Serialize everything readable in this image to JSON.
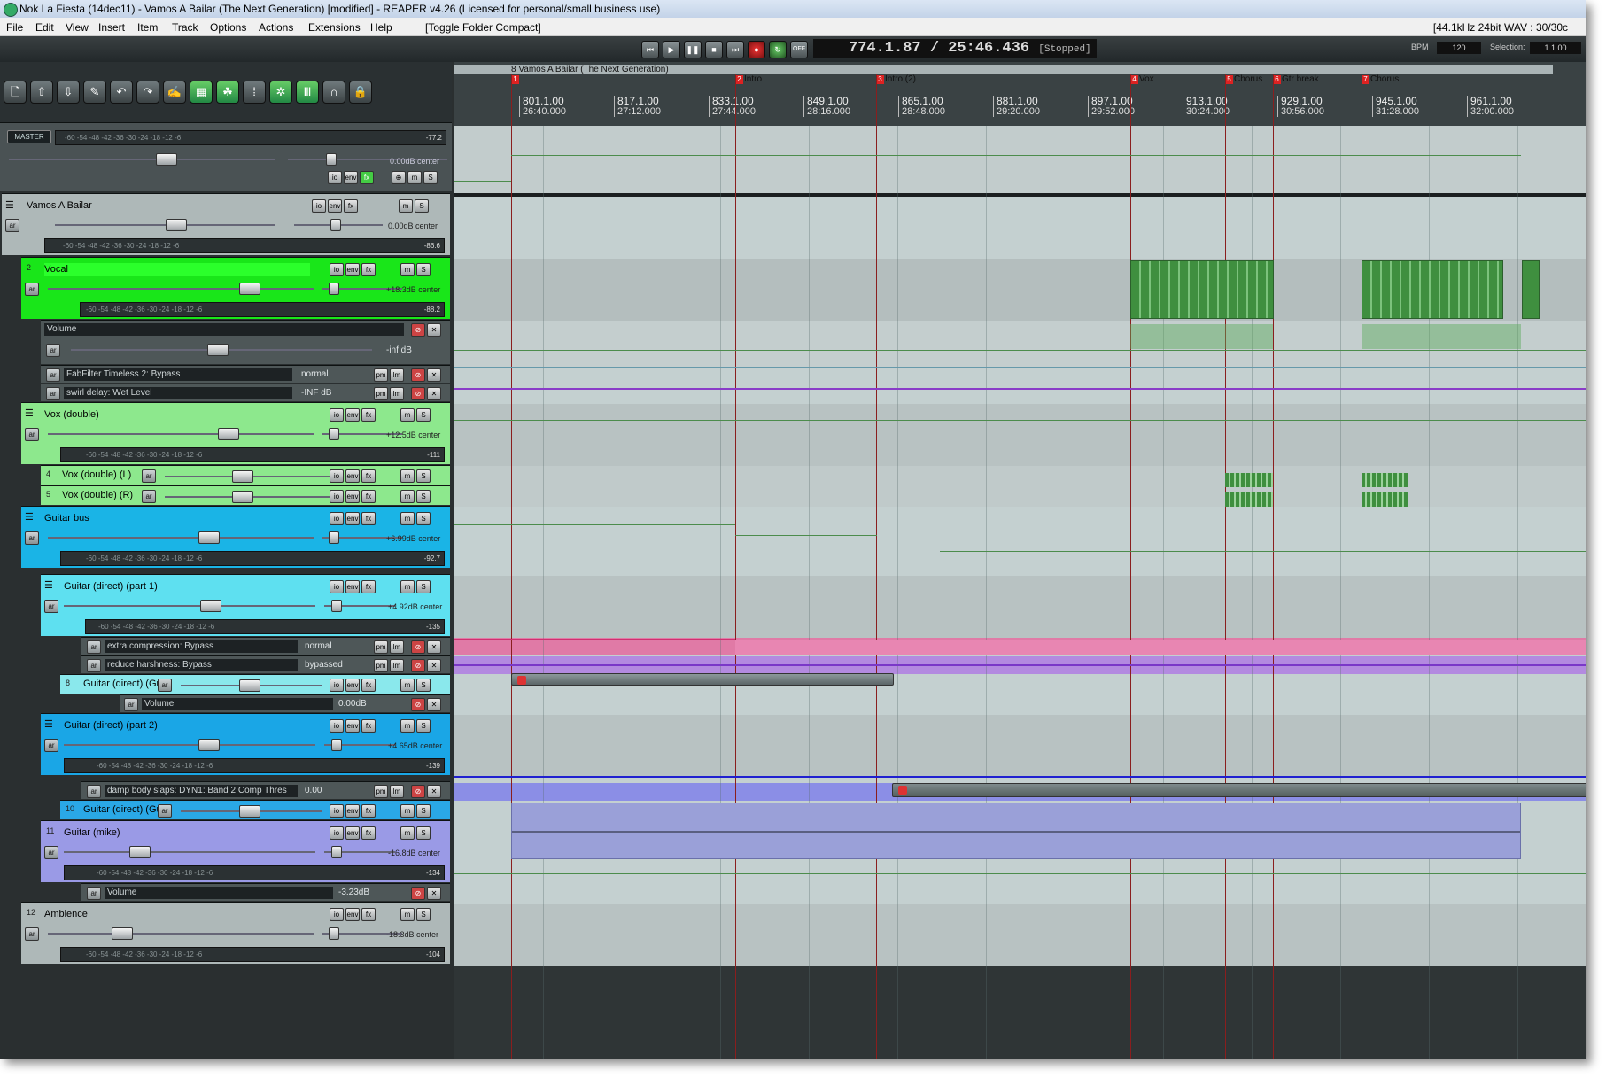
{
  "window": {
    "title": "Nok La Fiesta (14dec11) - Vamos A Bailar (The Next Generation) [modified] - REAPER v4.26 (Licensed for personal/small business use)",
    "format_info": "[44.1kHz 24bit WAV : 30/30c"
  },
  "menu": {
    "items": [
      "File",
      "Edit",
      "View",
      "Insert",
      "Item",
      "Track",
      "Options",
      "Actions",
      "Extensions",
      "Help"
    ],
    "toggle": "[Toggle Folder Compact]"
  },
  "transport": {
    "time": "774.1.87 / 25:46.436",
    "state": "[Stopped]",
    "bpm_label": "BPM",
    "bpm_value": "120",
    "selection_label": "Selection:",
    "selection_value": "1.1.00",
    "off_label": "OFF"
  },
  "master": {
    "label": "MASTER",
    "peak": "-77.2",
    "pan": "0.00dB center",
    "scale": "-60   -54   -48   -42   -36   -30   -24   -18   -12   -6"
  },
  "tracks": [
    {
      "num": "",
      "name": "Vamos A Bailar",
      "vol": "0.00dB center",
      "peak": "-86.6",
      "color": "#aeb8b8"
    },
    {
      "num": "2",
      "name": "Vocal",
      "vol": "+18.3dB center",
      "peak": "-88.2",
      "color": "#19e619"
    },
    {
      "num": "",
      "name": "Vox (double)",
      "vol": "+12.5dB center",
      "peak": "-111",
      "color": "#8de88d"
    },
    {
      "num": "4",
      "name": "Vox (double) (L)",
      "vol": "",
      "peak": "",
      "color": "#8de88d"
    },
    {
      "num": "5",
      "name": "Vox (double) (R)",
      "vol": "",
      "peak": "",
      "color": "#8de88d"
    },
    {
      "num": "",
      "name": "Guitar bus",
      "vol": "+6.99dB center",
      "peak": "-92.7",
      "color": "#1ab4e6"
    },
    {
      "num": "",
      "name": "Guitar (direct) (part 1)",
      "vol": "+4.92dB center",
      "peak": "-135",
      "color": "#5ee0f0"
    },
    {
      "num": "8",
      "name": "Guitar (direct) (Gu",
      "vol": "",
      "peak": "",
      "color": "#8ae8ec"
    },
    {
      "num": "",
      "name": "Guitar (direct) (part 2)",
      "vol": "+4.65dB center",
      "peak": "-139",
      "color": "#1aa6e6"
    },
    {
      "num": "10",
      "name": "Guitar (direct) (Gu",
      "vol": "",
      "peak": "",
      "color": "#2aa8e6"
    },
    {
      "num": "11",
      "name": "Guitar (mike)",
      "vol": "-16.8dB center",
      "peak": "-134",
      "color": "#9a9ae6"
    },
    {
      "num": "12",
      "name": "Ambience",
      "vol": "-18.3dB center",
      "peak": "-104",
      "color": "#aeb8b8"
    }
  ],
  "envelopes": {
    "vocal_volume": {
      "name": "Volume",
      "value": "-inf dB"
    },
    "timeless": {
      "name": "FabFilter Timeless 2: Bypass",
      "value": "normal"
    },
    "swirl": {
      "name": "swirl delay: Wet Level",
      "value": "-INF dB"
    },
    "extra_comp": {
      "name": "extra compression: Bypass",
      "value": "normal"
    },
    "reduce_harsh": {
      "name": "reduce harshness: Bypass",
      "value": "bypassed"
    },
    "gtr_volume": {
      "name": "Volume",
      "value": "0.00dB"
    },
    "damp": {
      "name": "damp body slaps: DYN1: Band 2 Comp Thres",
      "value": "0.00"
    },
    "mike_volume": {
      "name": "Volume",
      "value": "-3.23dB"
    }
  },
  "ruler": {
    "region": "8 Vamos A Bailar (The Next Generation)",
    "markers": [
      {
        "num": "1",
        "label": ""
      },
      {
        "num": "2",
        "label": "Intro"
      },
      {
        "num": "3",
        "label": "Intro (2)"
      },
      {
        "num": "4",
        "label": "Vox"
      },
      {
        "num": "5",
        "label": "Chorus"
      },
      {
        "num": "6",
        "label": "Gtr break"
      },
      {
        "num": "7",
        "label": "Chorus"
      }
    ],
    "ticks": [
      {
        "bar": "801.1.00",
        "time": "26:40.000"
      },
      {
        "bar": "817.1.00",
        "time": "27:12.000"
      },
      {
        "bar": "833.1.00",
        "time": "27:44.000"
      },
      {
        "bar": "849.1.00",
        "time": "28:16.000"
      },
      {
        "bar": "865.1.00",
        "time": "28:48.000"
      },
      {
        "bar": "881.1.00",
        "time": "29:20.000"
      },
      {
        "bar": "897.1.00",
        "time": "29:52.000"
      },
      {
        "bar": "913.1.00",
        "time": "30:24.000"
      },
      {
        "bar": "929.1.00",
        "time": "30:56.000"
      },
      {
        "bar": "945.1.00",
        "time": "31:28.000"
      },
      {
        "bar": "961.1.00",
        "time": "32:00.000"
      }
    ]
  },
  "labels": {
    "io": "io",
    "env": "env",
    "fx": "fx",
    "m": "m",
    "s": "S",
    "arm": "ar",
    "pm": "pm",
    "lm": "lm"
  },
  "toolbar": {
    "icons": [
      "new-project-icon",
      "open-icon",
      "save-icon",
      "settings-icon",
      "undo-icon",
      "redo-icon",
      "metronome-icon",
      "grid-icon",
      "snap-icon",
      "ripple-icon",
      "mixer-icon",
      "routing-icon",
      "headphones-icon",
      "lock-icon"
    ]
  }
}
